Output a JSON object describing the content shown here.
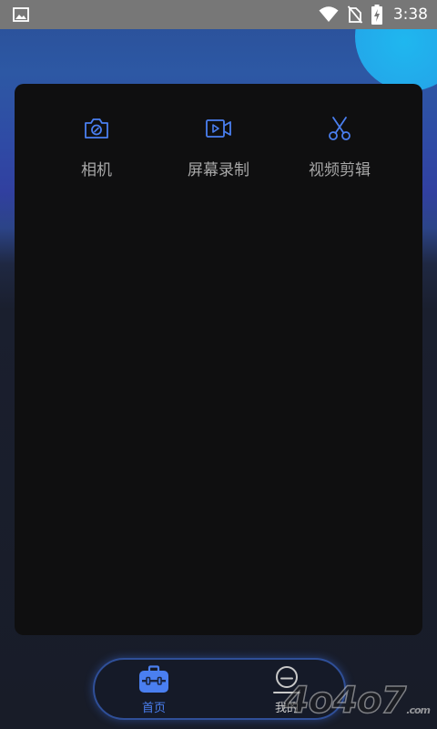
{
  "status_bar": {
    "time": "3:38",
    "icons": [
      "image-icon",
      "wifi-icon",
      "no-sim-icon",
      "battery-charging-icon"
    ]
  },
  "tools": [
    {
      "label": "相机",
      "icon": "camera-icon"
    },
    {
      "label": "屏幕录制",
      "icon": "screen-record-icon"
    },
    {
      "label": "视频剪辑",
      "icon": "scissors-icon"
    }
  ],
  "bottom_nav": {
    "items": [
      {
        "label": "首页",
        "icon": "toolbox-icon",
        "active": true
      },
      {
        "label": "我的",
        "icon": "profile-icon",
        "active": false
      }
    ]
  },
  "watermark": {
    "text": "4o4o7",
    "suffix": ".com"
  },
  "colors": {
    "accent": "#4a7ff0",
    "panel_bg": "#0f0f10",
    "status_bar_bg": "#777777",
    "label_gray": "#a7a7a7"
  }
}
